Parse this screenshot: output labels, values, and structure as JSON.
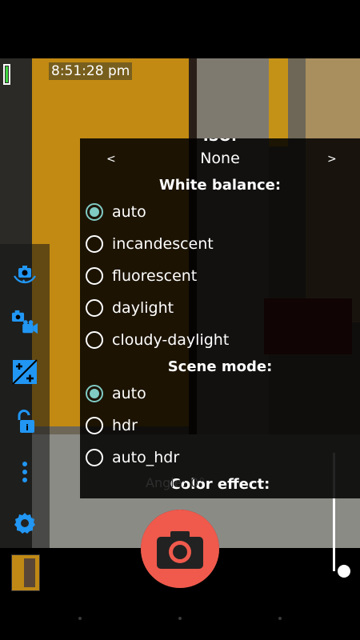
{
  "status": {
    "time": "8:51:28 pm",
    "battery_fraction": 0.85,
    "battery_color": "#3fd23f"
  },
  "popup": {
    "iso_title": "ISO:",
    "iso_value": "None",
    "prev_arrow": "<",
    "next_arrow": ">",
    "white_balance": {
      "title": "White balance:",
      "options": [
        "auto",
        "incandescent",
        "fluorescent",
        "daylight",
        "cloudy-daylight"
      ],
      "selected": "auto"
    },
    "scene_mode": {
      "title": "Scene mode:",
      "options": [
        "auto",
        "hdr",
        "auto_hdr"
      ],
      "selected": "auto"
    },
    "color_effect": {
      "title": "Color effect:"
    }
  },
  "overlay": {
    "angle_label": "Angle: 0°"
  },
  "sidebar": {
    "icons": [
      "switch-camera-icon",
      "switch-video-icon",
      "exposure-icon",
      "exposure-lock-icon",
      "more-options-icon",
      "settings-icon"
    ]
  },
  "colors": {
    "accent": "#2196f3",
    "radio_checked": "#80cbc4",
    "shutter": "#ef5a4c"
  },
  "zoom_level": 0.0
}
